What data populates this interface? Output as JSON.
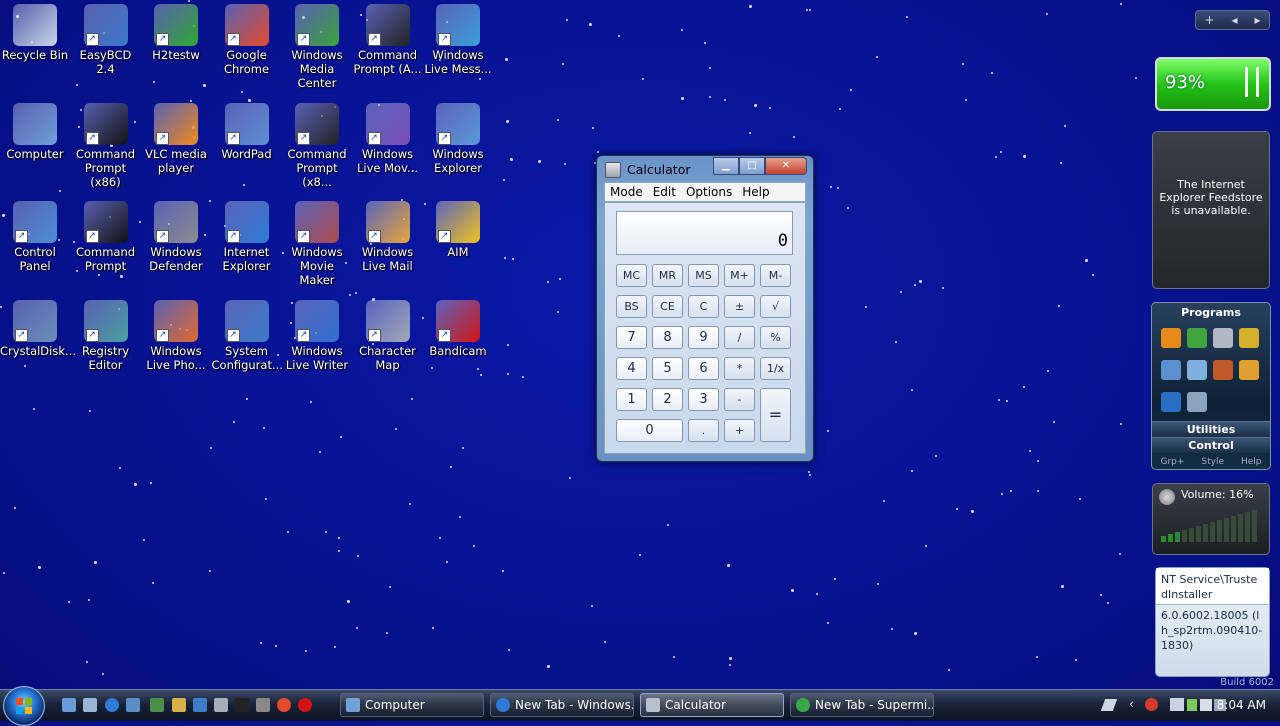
{
  "desktop": {
    "icons": [
      {
        "label": "Recycle Bin",
        "color": "#c9d6e8"
      },
      {
        "label": "EasyBCD 2.4",
        "color": "#3d78c8"
      },
      {
        "label": "H2testw",
        "color": "#2fa830"
      },
      {
        "label": "Google Chrome",
        "color": "#e44b2c"
      },
      {
        "label": "Windows Media Center",
        "color": "#3aa23a"
      },
      {
        "label": "Command Prompt (A...",
        "color": "#222222"
      },
      {
        "label": "Windows Live Mess...",
        "color": "#3aa0d8"
      },
      {
        "label": "Computer",
        "color": "#6fa0d8"
      },
      {
        "label": "Command Prompt (x86)",
        "color": "#111111"
      },
      {
        "label": "VLC media player",
        "color": "#f08a1c"
      },
      {
        "label": "WordPad",
        "color": "#5e8fd4"
      },
      {
        "label": "Command Prompt (x8...",
        "color": "#222222"
      },
      {
        "label": "Windows Live Mov...",
        "color": "#7a4fb8"
      },
      {
        "label": "Windows Explorer",
        "color": "#5a9ad8"
      },
      {
        "label": "Control Panel",
        "color": "#4c8fd4"
      },
      {
        "label": "Command Prompt",
        "color": "#111111"
      },
      {
        "label": "Windows Defender",
        "color": "#8c8c8c"
      },
      {
        "label": "Internet Explorer",
        "color": "#2e7cd6"
      },
      {
        "label": "Windows Movie Maker",
        "color": "#b04a4a"
      },
      {
        "label": "Windows Live Mail",
        "color": "#e8a53a"
      },
      {
        "label": "AIM",
        "color": "#f2c21c"
      },
      {
        "label": "CrystalDisk...",
        "color": "#6a8fb8"
      },
      {
        "label": "Registry Editor",
        "color": "#4aa0a0"
      },
      {
        "label": "Windows Live Pho...",
        "color": "#e06a2a"
      },
      {
        "label": "System Configurat...",
        "color": "#3c7cc8"
      },
      {
        "label": "Windows Live Writer",
        "color": "#2f6fd0"
      },
      {
        "label": "Character Map",
        "color": "#a0a8b8"
      },
      {
        "label": "Bandicam",
        "color": "#d41414"
      }
    ]
  },
  "calculator": {
    "title": "Calculator",
    "menu": [
      "Mode",
      "Edit",
      "Options",
      "Help"
    ],
    "display": "0",
    "buttons": {
      "mc": "MC",
      "mr": "MR",
      "ms": "MS",
      "mplus": "M+",
      "mminus": "M-",
      "bs": "BS",
      "ce": "CE",
      "c": "C",
      "pm": "±",
      "sqrt": "√",
      "n7": "7",
      "n8": "8",
      "n9": "9",
      "div": "/",
      "pct": "%",
      "n4": "4",
      "n5": "5",
      "n6": "6",
      "mul": "*",
      "inv": "1/x",
      "n1": "1",
      "n2": "2",
      "n3": "3",
      "sub": "-",
      "eq": "=",
      "n0": "0",
      "dot": ".",
      "add": "+"
    }
  },
  "taskbar": {
    "buttons": [
      {
        "label": "Computer",
        "active": false
      },
      {
        "label": "New Tab - Windows...",
        "active": false
      },
      {
        "label": "Calculator",
        "active": true
      },
      {
        "label": "New Tab - Supermi...",
        "active": false
      }
    ],
    "clock": "8:04 AM"
  },
  "sidebar": {
    "battery": "93%",
    "feed_message": "The Internet Explorer Feedstore is unavailable.",
    "programs_title": "Programs",
    "utilities": "Utilities",
    "control": "Control",
    "footer": [
      "Grp+",
      "Style",
      "Help"
    ],
    "volume": "Volume: 16%",
    "info_user": "NT Service\\TrustedInstaller",
    "info_version": "6.0.6002.18005 (lh_sp2rtm.090410-1830)",
    "build": "Build 6002"
  }
}
